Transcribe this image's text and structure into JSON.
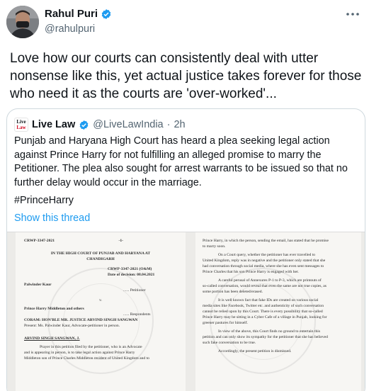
{
  "author": {
    "name": "Rahul Puri",
    "handle": "@rahulpuri"
  },
  "tweet_text": "Love how our courts can consistently deal with utter nonsense like this, yet actual justice takes forever for those who need it as the courts are 'over-worked'...",
  "quote": {
    "logo_line1": "Live",
    "logo_line2": "Law",
    "name": "Live Law",
    "handle": "@LiveLawIndia",
    "dot": "·",
    "time": "2h",
    "text": "Punjab and Haryana High Court has heard a plea seeking legal action against Prince Harry for not fulfilling an alleged promise to marry the Petitioner. The plea also sought for arrest warrants to be issued so that no further delay would occur in the marriage.",
    "hashtag": "#PrinceHarry",
    "show_thread": "Show this thread"
  },
  "doc_left": {
    "case_no": "CRWP-3347-2021",
    "page_no": "-1-",
    "court_1": "IN THE HIGH COURT OF PUNJAB AND HARYANA AT",
    "court_2": "CHANDIGARH",
    "case_ref": "CRWP-3347-2021 (O&M)",
    "decision": "Date of decision: 08.04.2021",
    "petitioner": "Palwinder Kaur",
    "petitioner_role": "...... Petitioner",
    "versus": "v.",
    "respondent": "Prince Harry Middleton and others",
    "respondent_role": "...... Respondents",
    "coram": "CORAM:  HON'BLE MR. JUSTICE ARVIND SINGH SANGWAN",
    "present": "Present:    Ms. Palwinder Kaur, Advocate-petitioner in person.",
    "judge": "ARVIND SINGH SANGWAN, J.",
    "para_1": "Prayer in this petition filed by the petitioner, who is an Advocate",
    "para_2": "and is appearing in person, is to take legal action against Prince Harry",
    "para_3": "Middleton son of Prince Charles Middleton resident of United Kingdom and to"
  },
  "doc_right": {
    "r1": "Prince Harry, in which the person, sending the email, has stated that he promise",
    "r2": "to marry soon.",
    "r3": "On a Court query, whether the petitioner has ever travelled to",
    "r4": "United Kingdom, reply was in negative and the petitioner only stated that she",
    "r5": "had conversation through social media, where she has even sent messages to",
    "r6": "Prince Charles that his son Prince Harry is engaged with her.",
    "r7": "A careful perusal of Annexures P-1 to P-3, which are printouts of",
    "r8": "so-called conversation, would reveal that even the same are not true copies, as",
    "r9": "some portion has been deleted/erased.",
    "r10": "It is well known fact that fake IDs are created on various social",
    "r11": "media sites like Facebook, Twitter etc. and authenticity of such conversation",
    "r12": "cannot be relied upon by this Court. There is every possibility that so-called",
    "r13": "Prince Harry may be sitting in a Cyber Cafe of a village in Punjab, looking for",
    "r14": "greener pastures for himself.",
    "r15": "In view of the above, this Court finds no ground to entertain this",
    "r16": "petition and can only show its sympathy for the petitioner that she has believed",
    "r17": "such fake conversation to be true.",
    "r18": "Accordingly, the present petition is dismissed."
  },
  "colors": {
    "link": "#1d9bf0",
    "verified": "#1d9bf0",
    "secondary_text": "#536471",
    "border": "#cfd9de"
  }
}
